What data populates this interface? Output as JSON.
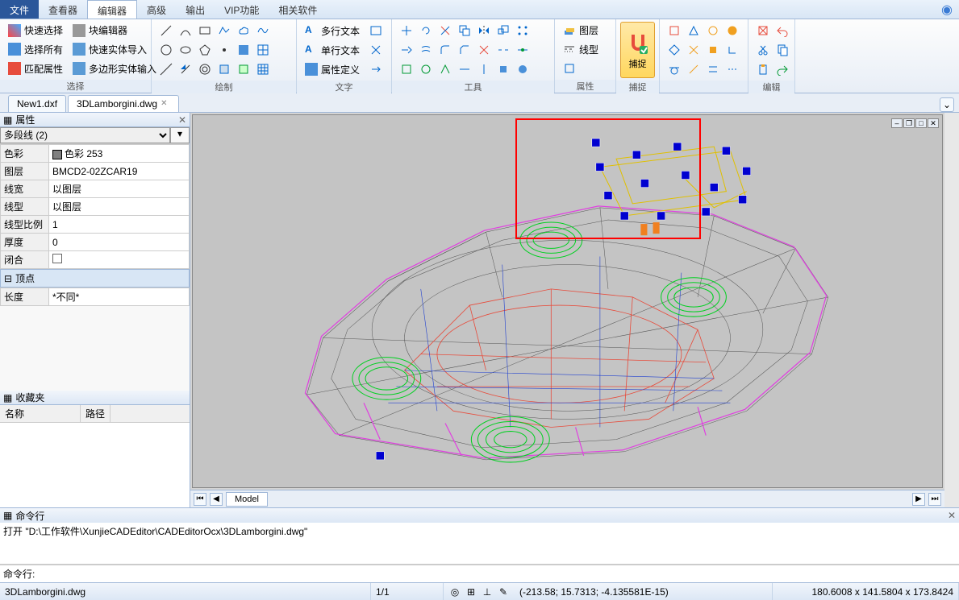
{
  "menu": {
    "file": "文件",
    "viewer": "查看器",
    "editor": "编辑器",
    "advanced": "高级",
    "output": "输出",
    "vip": "VIP功能",
    "related": "相关软件"
  },
  "ribbon": {
    "select": {
      "quick_select": "快速选择",
      "select_all": "选择所有",
      "match_props": "匹配属性",
      "block_editor": "块编辑器",
      "quick_import": "快速实体导入",
      "poly_import": "多边形实体输入",
      "label": "选择"
    },
    "draw_label": "绘制",
    "text": {
      "multiline": "多行文本",
      "singleline": "单行文本",
      "propdef": "属性定义",
      "label": "文字"
    },
    "tools_label": "工具",
    "props": {
      "layer": "图层",
      "linetype": "线型",
      "label": "属性"
    },
    "snap": {
      "btn": "捕捉",
      "label": "捕捉"
    },
    "edit_label": "编辑"
  },
  "tabs": {
    "tab1": "New1.dxf",
    "tab2": "3DLamborgini.dwg"
  },
  "props_panel": {
    "title": "属性",
    "selector": "多段线 (2)",
    "color_label": "色彩",
    "color_value": "色彩 253",
    "layer_label": "图层",
    "layer_value": "BMCD2-02ZCAR19",
    "lineweight_label": "线宽",
    "lineweight_value": "以图层",
    "linetype_label": "线型",
    "linetype_value": "以图层",
    "ltscale_label": "线型比例",
    "ltscale_value": "1",
    "thickness_label": "厚度",
    "thickness_value": "0",
    "closed_label": "闭合",
    "vertex_label": "顶点",
    "length_label": "长度",
    "length_value": "*不同*"
  },
  "favorites": {
    "title": "收藏夹",
    "col_name": "名称",
    "col_path": "路径"
  },
  "model_tab": "Model",
  "cmd": {
    "title": "命令行",
    "log": "打开 \"D:\\工作软件\\XunjieCADEditor\\CADEditorOcx\\3DLamborgini.dwg\"",
    "prompt": "命令行:"
  },
  "status": {
    "file": "3DLamborgini.dwg",
    "page": "1/1",
    "coords": "(-213.58; 15.7313; -4.135581E-15)",
    "dims": "180.6008 x 141.5804 x 173.8424"
  }
}
